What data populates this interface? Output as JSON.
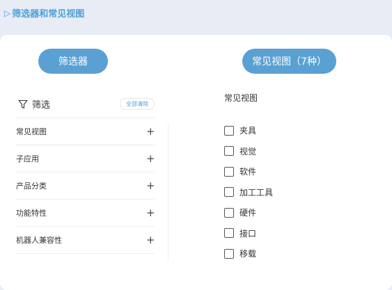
{
  "page": {
    "title_icon": "triangle-right-icon",
    "title": "筛选器和常见视图"
  },
  "tabs": {
    "filter_label": "筛选器",
    "views_label": "常见视图（7种）"
  },
  "filter": {
    "heading": "筛选",
    "clear_label": "全部清除",
    "categories": [
      {
        "label": "常见视图",
        "icon": "plus-icon"
      },
      {
        "label": "子应用",
        "icon": "plus-icon"
      },
      {
        "label": "产品分类",
        "icon": "plus-icon"
      },
      {
        "label": "功能特性",
        "icon": "plus-icon"
      },
      {
        "label": "机器人兼容性",
        "icon": "plus-icon"
      }
    ]
  },
  "views": {
    "heading": "常见视图",
    "items": [
      {
        "label": "夹具",
        "checked": false
      },
      {
        "label": "视觉",
        "checked": false
      },
      {
        "label": "软件",
        "checked": false
      },
      {
        "label": "加工工具",
        "checked": false
      },
      {
        "label": "硬件",
        "checked": false
      },
      {
        "label": "接口",
        "checked": false
      },
      {
        "label": "移载",
        "checked": false
      }
    ]
  },
  "colors": {
    "accent": "#5aa0d3",
    "title": "#4f9fd6",
    "background": "#e8ecf5",
    "card": "#ffffff"
  }
}
